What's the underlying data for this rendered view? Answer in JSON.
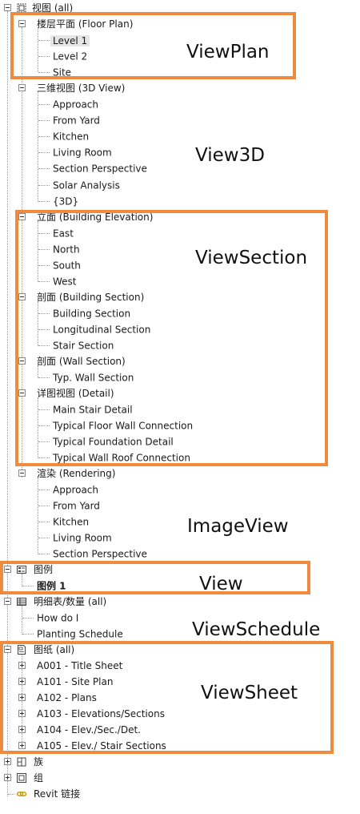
{
  "tree": {
    "root": "视图 (all)",
    "floor_plan": {
      "label": "楼层平面 (Floor Plan)",
      "items": [
        "Level 1",
        "Level 2",
        "Site"
      ]
    },
    "view3d": {
      "label": "三维视图 (3D View)",
      "items": [
        "Approach",
        "From Yard",
        "Kitchen",
        "Living Room",
        "Section Perspective",
        "Solar Analysis",
        "{3D}"
      ]
    },
    "elevation": {
      "label": "立面 (Building Elevation)",
      "items": [
        "East",
        "North",
        "South",
        "West"
      ]
    },
    "building_section": {
      "label": "剖面 (Building Section)",
      "items": [
        "Building Section",
        "Longitudinal Section",
        "Stair Section"
      ]
    },
    "wall_section": {
      "label": "剖面 (Wall Section)",
      "items": [
        "Typ. Wall Section"
      ]
    },
    "detail": {
      "label": "详图视图 (Detail)",
      "items": [
        "Main Stair Detail",
        "Typical Floor Wall Connection",
        "Typical Foundation Detail",
        "Typical Wall Roof Connection"
      ]
    },
    "rendering": {
      "label": "渲染 (Rendering)",
      "items": [
        "Approach",
        "From Yard",
        "Kitchen",
        "Living Room",
        "Section Perspective"
      ]
    },
    "legends": {
      "label": "图例",
      "items": [
        "图例 1"
      ]
    },
    "schedules": {
      "label": "明细表/数量 (all)",
      "items": [
        "How do I",
        "Planting Schedule"
      ]
    },
    "sheets": {
      "label": "图纸 (all)",
      "items": [
        "A001 - Title Sheet",
        "A101 - Site Plan",
        "A102 - Plans",
        "A103 - Elevations/Sections",
        "A104 - Elev./Sec./Det.",
        "A105 - Elev./ Stair Sections"
      ]
    },
    "families": "族",
    "groups": "组",
    "revit_links": "Revit 链接"
  },
  "annotations": {
    "view_plan": "ViewPlan",
    "view3d": "View3D",
    "view_section": "ViewSection",
    "image_view": "ImageView",
    "view": "View",
    "view_schedule": "ViewSchedule",
    "view_sheet": "ViewSheet"
  },
  "colors": {
    "highlight_box": "#f08a3c",
    "selection_bg": "#e5e5e5"
  },
  "icons": {
    "root": "view-icon",
    "legends": "legend-icon",
    "schedules": "schedule-icon",
    "sheets": "sheet-icon",
    "families": "family-icon",
    "groups": "group-icon",
    "revit_links": "link-icon"
  }
}
